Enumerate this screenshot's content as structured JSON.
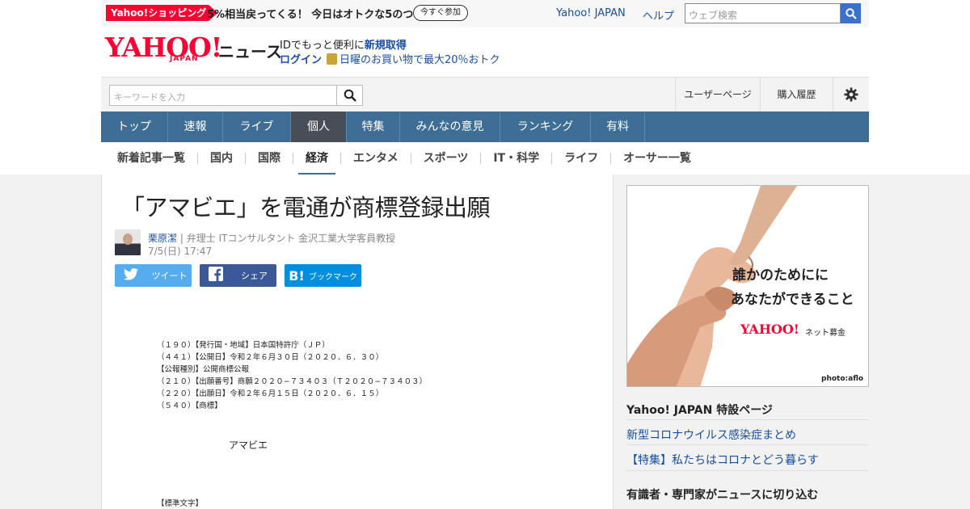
{
  "promo": {
    "tag": "Yahoo!ショッピング",
    "text": "5%相当戻ってくる！ 今日はオトクな5のつく日",
    "button": "今すぐ参加"
  },
  "util": {
    "yahoo_japan": "Yahoo! JAPAN",
    "help": "ヘルプ",
    "search_placeholder": "ウェブ検索"
  },
  "header": {
    "logo": "YAHOO!",
    "logo_sub": "JAPAN",
    "service": "ニュース",
    "id_text": "IDでもっと便利に",
    "id_link": "新規取得",
    "login": "ログイン",
    "promo_link": "日曜のお買い物で最大20％おトク"
  },
  "search": {
    "placeholder": "キーワードを入力",
    "user_page": "ユーザーページ",
    "purchase_history": "購入履歴"
  },
  "main_nav": [
    "トップ",
    "速報",
    "ライブ",
    "個人",
    "特集",
    "みんなの意見",
    "ランキング",
    "有料"
  ],
  "sub_nav": [
    "新着記事一覧",
    "国内",
    "国際",
    "経済",
    "エンタメ",
    "スポーツ",
    "IT・科学",
    "ライフ",
    "オーサー一覧"
  ],
  "article": {
    "title": "「アマビエ」を電通が商標登録出願",
    "author_name": "栗原潔",
    "author_desc": " | 弁理士 ITコンサルタント 金沢工業大学客員教授",
    "date": "7/5(日) 17:47",
    "share": {
      "tweet": "ツイート",
      "share": "シェア",
      "bookmark": "ブックマーク"
    },
    "doc_lines": [
      "（１９０）【発行国・地域】日本国特許庁（ＪＰ）",
      "（４４１）【公開日】令和２年６月３０日（２０２０．６．３０）",
      "【公報種別】公開商標公報",
      "（２１０）【出願番号】商願２０２０−７３４０３（Ｔ２０２０−７３４０３）",
      "（２２０）【出願日】令和２年６月１５日（２０２０．６．１５）",
      "（５４０）【商標】"
    ],
    "doc_mark": "アマビエ",
    "doc_std": "【標準文字】"
  },
  "ad": {
    "line1": "誰かのためにに",
    "line2": "あなたができること",
    "logo": "YAHOO!",
    "logo_sub": "ネット募金",
    "credit": "photo:aflo"
  },
  "sidebar": {
    "special_head": "Yahoo! JAPAN 特設ページ",
    "links": [
      "新型コロナウイルス感染症まとめ",
      "【特集】私たちはコロナとどう暮らす"
    ],
    "experts_head": "有識者・専門家がニュースに切り込む"
  }
}
